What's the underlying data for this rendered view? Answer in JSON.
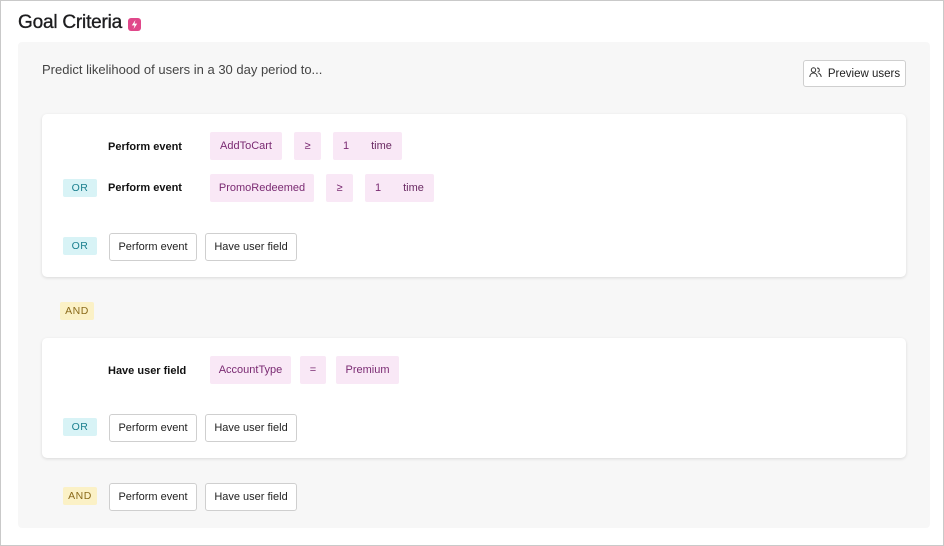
{
  "header": {
    "title": "Goal Criteria",
    "badge_icon": "lightning-icon",
    "badge_color": "#e0488a"
  },
  "intro": {
    "text": "Predict likelihood of users in a 30 day period to..."
  },
  "preview": {
    "label": "Preview users",
    "icon": "users-icon"
  },
  "group1": {
    "row1": {
      "label": "Perform event",
      "event": "AddToCart",
      "operator": "≥",
      "count": "1",
      "unit": "time"
    },
    "row2": {
      "connector": "OR",
      "label": "Perform event",
      "event": "PromoRedeemed",
      "operator": "≥",
      "count": "1",
      "unit": "time"
    },
    "add_row": {
      "connector": "OR",
      "perform_event": "Perform event",
      "have_user_field": "Have user field"
    }
  },
  "and_between": "AND",
  "group2": {
    "row1": {
      "label": "Have user field",
      "field": "AccountType",
      "operator": "=",
      "value": "Premium"
    },
    "add_row": {
      "connector": "OR",
      "perform_event": "Perform event",
      "have_user_field": "Have user field"
    }
  },
  "bottom": {
    "connector": "AND",
    "perform_event": "Perform event",
    "have_user_field": "Have user field"
  },
  "colors": {
    "chip_bg": "#f9e8f6",
    "chip_text": "#7a2a72",
    "or_bg": "#d8f3f6",
    "or_text": "#1a7f8e",
    "and_bg": "#fbf1c6",
    "and_text": "#8a6a1a"
  }
}
